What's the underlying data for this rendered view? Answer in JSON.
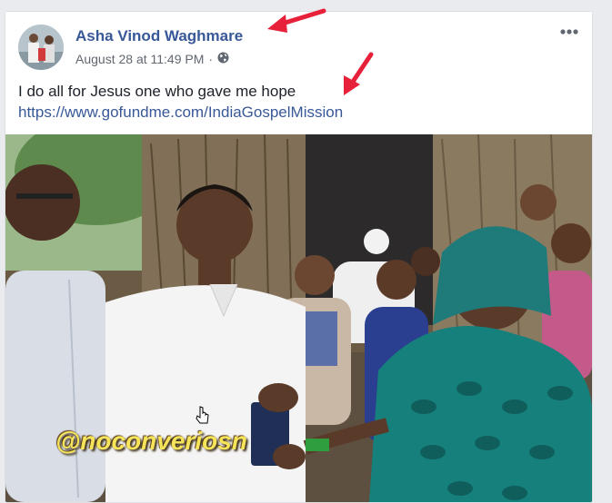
{
  "post": {
    "author": "Asha Vinod Waghmare",
    "timestamp": "August 28 at 11:49 PM",
    "separator": "·",
    "privacy_icon": "globe-icon",
    "more_icon": "more-options-icon",
    "text": "I do all for Jesus one who gave me hope",
    "link": "https://www.gofundme.com/IndiaGospelMission"
  },
  "photo": {
    "watermark": "@noconveriosn"
  },
  "colors": {
    "author_link": "#385898",
    "annotation_arrow": "#e8213b",
    "watermark": "#f6e45a"
  }
}
